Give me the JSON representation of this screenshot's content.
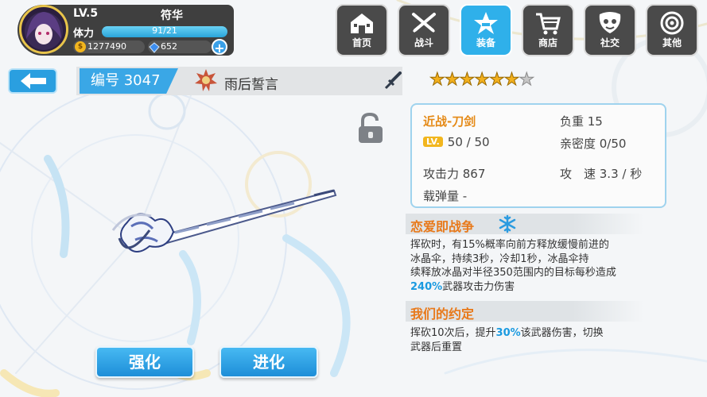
{
  "player": {
    "level": "LV.5",
    "name": "符华",
    "stamina_label": "体力",
    "stamina_text": "91/21",
    "coins": "1277490",
    "gems": "652"
  },
  "nav": [
    {
      "label": "首页",
      "icon": "home-icon"
    },
    {
      "label": "战斗",
      "icon": "battle-swords-icon"
    },
    {
      "label": "装备",
      "icon": "equipment-star-icon"
    },
    {
      "label": "商店",
      "icon": "shop-basket-icon"
    },
    {
      "label": "社交",
      "icon": "social-mask-icon"
    },
    {
      "label": "其他",
      "icon": "other-target-icon"
    }
  ],
  "weapon": {
    "number_label": "编号 3047",
    "name": "雨后誓言",
    "stars_filled": 6,
    "stars_total": 7
  },
  "stats": {
    "category": "近战-刀剑",
    "weight": "负重 15",
    "level_badge": "LV.",
    "level": "50 / 50",
    "intimacy": "亲密度 0/50",
    "attack": "攻击力 867",
    "speed": "攻　速 3.3 / 秒",
    "ammo": "载弹量 -"
  },
  "skills": [
    {
      "title": "恋爱即战争",
      "lines": [
        [
          "挥砍时，有15%概率向前方释放缓慢前进的"
        ],
        [
          "冰晶伞，持续3秒，冷却1秒，冰晶伞持"
        ],
        [
          "续释放冰晶对半径350范围内的目标每秒造成"
        ],
        [
          "240%",
          "武器攻击力伤害"
        ]
      ]
    },
    {
      "title": "我们的约定",
      "lines": [
        [
          "挥砍10次后，提升",
          "30%",
          "该武器伤害，切换"
        ],
        [
          "武器后重置"
        ]
      ]
    }
  ],
  "buttons": {
    "enhance": "强化",
    "evolve": "进化"
  },
  "colors": {
    "accent": "#2fb0ea",
    "orange": "#e8791a",
    "star": "#f2b01e"
  }
}
